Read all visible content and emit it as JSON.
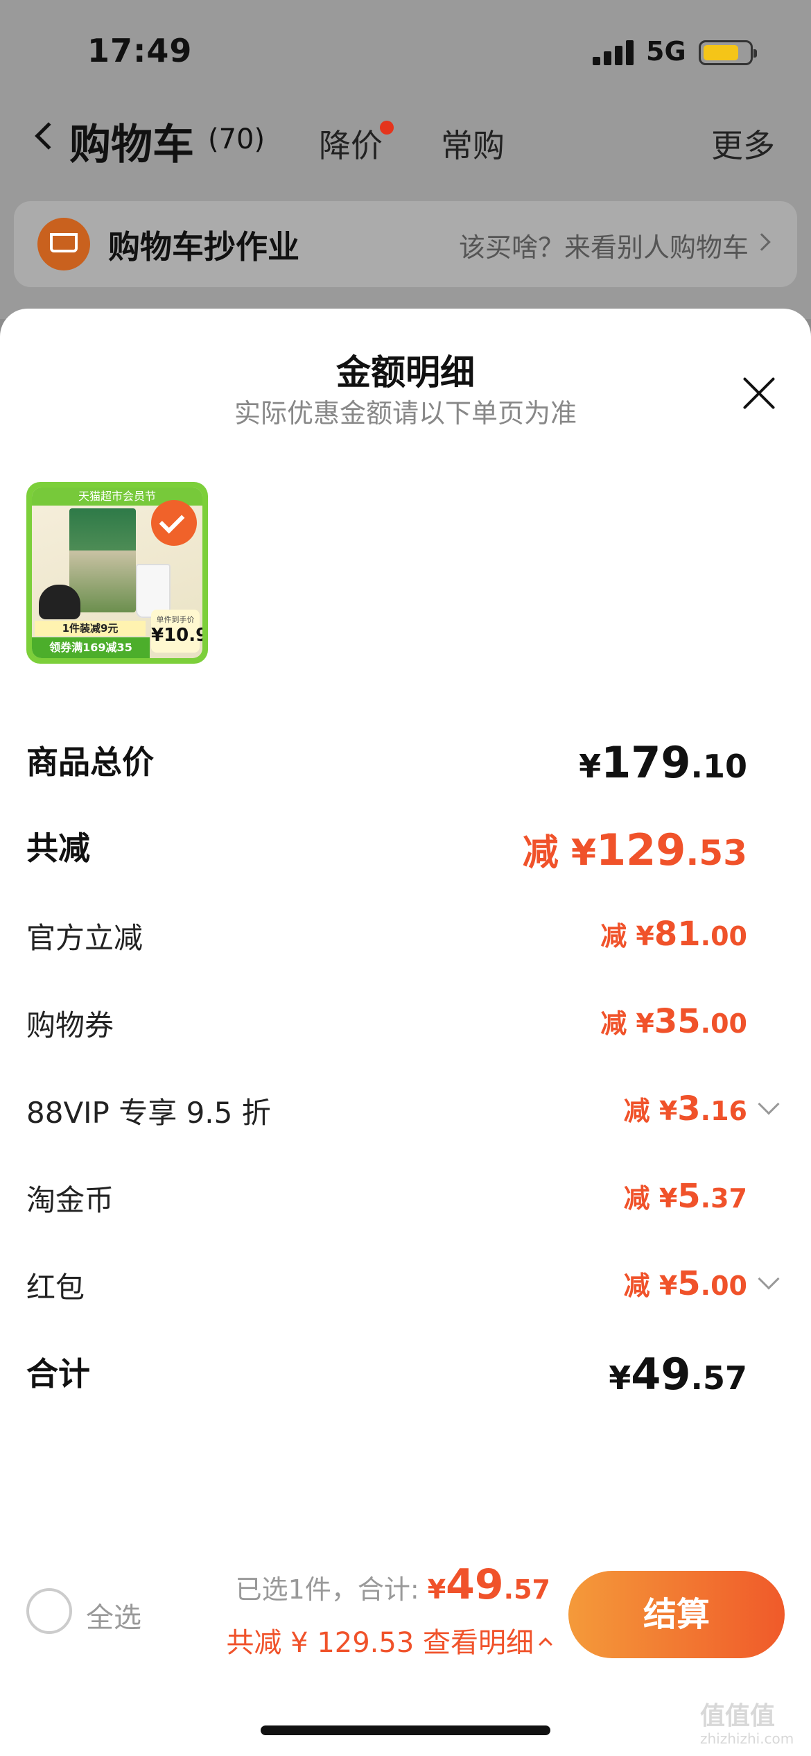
{
  "status_bar": {
    "time": "17:49",
    "network": "5G"
  },
  "nav": {
    "title": "购物车",
    "count": "(70)",
    "tabs": [
      "降价",
      "常购"
    ],
    "more": "更多"
  },
  "banner": {
    "title": "购物车抄作业",
    "subtitle": "该买啥？来看别人购物车"
  },
  "sheet": {
    "title": "金额明细",
    "subtitle": "实际优惠金额请以下单页为准"
  },
  "product": {
    "top_strip": "天猫超市会员节",
    "promo1": "1件装减9元",
    "promo2": "领券满169减35",
    "price_label": "单件到手价",
    "price_value": "¥10.9"
  },
  "rows": [
    {
      "label": "商品总价",
      "prefix": "",
      "currency": "¥",
      "int": "179",
      "dec": ".10"
    },
    {
      "label": "共减",
      "prefix": "减 ",
      "currency": "¥",
      "int": "129",
      "dec": ".53"
    },
    {
      "label": "官方立减",
      "prefix": "减 ",
      "currency": "¥",
      "int": "81",
      "dec": ".00"
    },
    {
      "label": "购物券",
      "prefix": "减 ",
      "currency": "¥",
      "int": "35",
      "dec": ".00"
    },
    {
      "label": "88VIP 专享 9.5 折",
      "prefix": "减 ",
      "currency": "¥",
      "int": "3",
      "dec": ".16"
    },
    {
      "label": "淘金币",
      "prefix": "减 ",
      "currency": "¥",
      "int": "5",
      "dec": ".37"
    },
    {
      "label": "红包",
      "prefix": "减 ",
      "currency": "¥",
      "int": "5",
      "dec": ".00"
    },
    {
      "label": "合计",
      "prefix": "",
      "currency": "¥",
      "int": "49",
      "dec": ".57"
    }
  ],
  "bottom": {
    "select_all": "全选",
    "selected_text": "已选1件，合计: ",
    "total_currency": "¥",
    "total_int": "49",
    "total_dec": ".57",
    "saved_text": "共减 ¥ 129.53 查看明细",
    "checkout": "结算"
  },
  "watermark": {
    "main": "值值值",
    "sub": "zhizhizhi.com"
  },
  "colors": {
    "accent": "#f0522a",
    "checkout_start": "#f49a3a",
    "checkout_end": "#f05a2a"
  }
}
